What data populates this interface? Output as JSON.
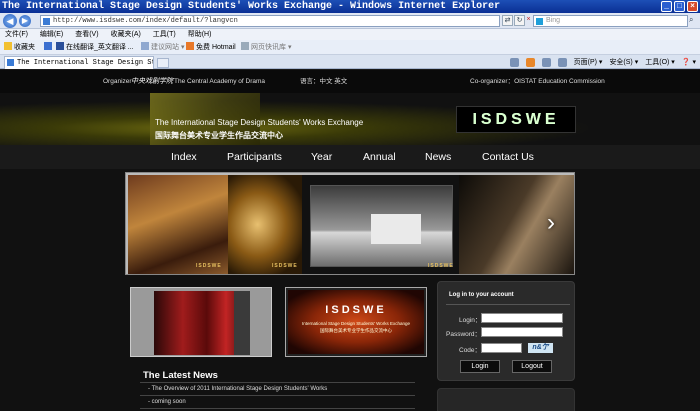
{
  "browser": {
    "window_title": "The International Stage Design Students' Works Exchange - Windows Internet Explorer",
    "address": "http://www.isdswe.com/index/default/?langvcn",
    "search_placeholder": "Bing",
    "menu": [
      "文件(F)",
      "编辑(E)",
      "查看(V)",
      "收藏夹(A)",
      "工具(T)",
      "帮助(H)"
    ],
    "favorites": {
      "label": "收藏夹",
      "items": [
        "在线翻译_英文翻译 ...",
        "建议网站 ▾",
        "免费 Hotmail",
        "网页快讯库 ▾"
      ]
    },
    "tab_title": "The International Stage Design Stud...",
    "commands": [
      "页面(P) ▾",
      "安全(S) ▾",
      "工具(O) ▾",
      "❓ ▾"
    ]
  },
  "site": {
    "organizer_label": "Organizer",
    "organizer_calligraphy": "中央戏剧学院",
    "organizer_name": "The Central Academy of Drama",
    "language": "语言：中文  英文",
    "co_organizer": "Co-organizer：OISTAT Education Commission",
    "banner_title_en": "The International Stage Design Students' Works Exchange",
    "banner_title_cn": "国际舞台美术专业学生作品交流中心",
    "logo": "ISDSWE",
    "nav": [
      "Index",
      "Participants",
      "Year",
      "Annual",
      "News",
      "Contact Us"
    ],
    "gallery_badge": "ISDSWE",
    "thumb_logo": "ISDSWE",
    "thumb_sub1": "International Stage Design Students' Works Exchange",
    "thumb_sub2": "国际舞台美术专业学生作品交流中心",
    "news": {
      "title": "The Latest News",
      "items": [
        "The Overview of 2011 International Stage Design Students' Works",
        "coming soon"
      ]
    },
    "login": {
      "title": "Log in to your account",
      "login_label": "Login：",
      "password_label": "Password：",
      "code_label": "Code：",
      "captcha": "n&亇",
      "login_button": "Login",
      "logout_button": "Logout"
    }
  }
}
